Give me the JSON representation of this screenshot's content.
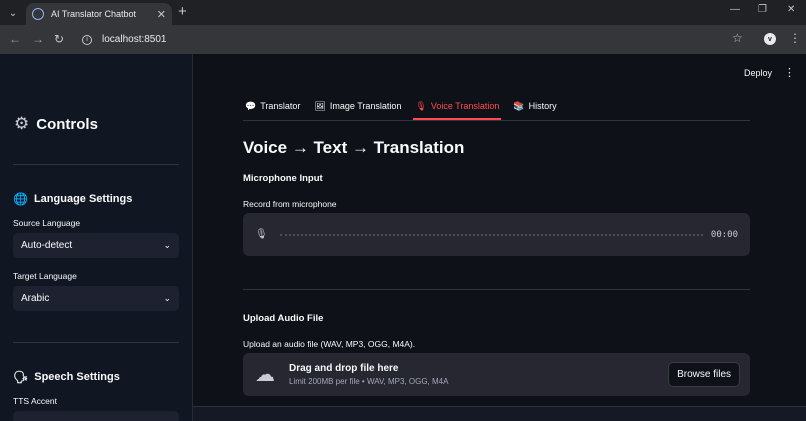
{
  "browser": {
    "tab_title": "AI Translator Chatbot",
    "url": "localhost:8501",
    "profile_initial": "v",
    "colors": {
      "chrome_bg": "#202124",
      "toolbar_bg": "#35363a",
      "accent": "#ff4b4b"
    }
  },
  "sidebar": {
    "title": "Controls",
    "title_icon": "gear-icon",
    "language_section": {
      "heading": "Language Settings",
      "icon": "globe-icon"
    },
    "source_label": "Source Language",
    "source_value": "Auto-detect",
    "target_label": "Target Language",
    "target_value": "Arabic",
    "speech_section": {
      "heading": "Speech Settings",
      "icon": "speaking-head-icon"
    },
    "tts_label": "TTS Accent"
  },
  "header": {
    "deploy_label": "Deploy"
  },
  "main": {
    "tabs": [
      {
        "label": "Translator",
        "icon": "speech-bubble-icon"
      },
      {
        "label": "Image Translation",
        "icon": "picture-icon"
      },
      {
        "label": "Voice Translation",
        "icon": "microphone-icon",
        "active": true
      },
      {
        "label": "History",
        "icon": "books-icon"
      }
    ],
    "heading": "Voice → Text → Translation",
    "mic_section": "Microphone Input",
    "mic_caption": "Record from microphone",
    "timer": "00:00",
    "upload_section": "Upload Audio File",
    "upload_caption": "Upload an audio file (WAV, MP3, OGG, M4A).",
    "dropzone_title": "Drag and drop file here",
    "dropzone_sub": "Limit 200MB per file • WAV, MP3, OGG, M4A",
    "browse_label": "Browse files"
  }
}
